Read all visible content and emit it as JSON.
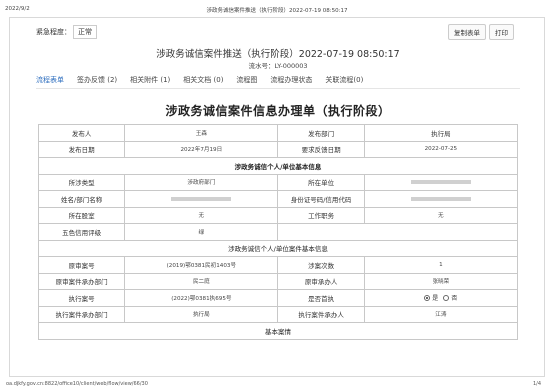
{
  "print_header": {
    "date": "2022/9/2",
    "title": "涉政务诚信案件推送（执行阶段）2022-07-19 08:50:17"
  },
  "urgency": {
    "label": "紧急程度：",
    "value": "正常"
  },
  "toolbar": {
    "copy_label": "复制表单",
    "print_label": "打印"
  },
  "case": {
    "title": "涉政务诚信案件推送（执行阶段）2022-07-19 08:50:17",
    "flow_no": "流水号：LY-000003"
  },
  "tabs": [
    {
      "label": "流程表单",
      "active": true
    },
    {
      "label": "签办反馈 (2)"
    },
    {
      "label": "相关附件 (1)"
    },
    {
      "label": "相关文档 (0)"
    },
    {
      "label": "流程图"
    },
    {
      "label": "流程办理状态"
    },
    {
      "label": "关联流程(0)"
    }
  ],
  "form": {
    "title": "涉政务诚信案件信息办理单（执行阶段）",
    "row1": {
      "l1": "发布人",
      "v1": "王森",
      "l2": "发布部门",
      "v2": "执行局"
    },
    "row2": {
      "l1": "发布日期",
      "v1": "2022年7月19日",
      "l2": "要求反馈日期",
      "v2": "2022-07-25"
    },
    "section1": "涉政务诚信个人/单位基本信息",
    "row3": {
      "l1": "所涉类型",
      "v1": "涉政府部门",
      "l2": "所在单位",
      "v2": ""
    },
    "row4": {
      "l1": "姓名/部门名称",
      "v1": "",
      "l2": "身份证号码/信用代码",
      "v2": ""
    },
    "row5": {
      "l1": "所在股室",
      "v1": "无",
      "l2": "工作职务",
      "v2": "无"
    },
    "row6": {
      "l1": "五色信用评级",
      "v1": "绿"
    },
    "section2": "涉政务诚信个人/单位案件基本信息",
    "row7": {
      "l1": "原审案号",
      "v1": "(2019)鄂0381民初1403号",
      "l2": "涉案次数",
      "v2": "1"
    },
    "row8": {
      "l1": "原审案件承办部门",
      "v1": "民二庭",
      "l2": "原审承办人",
      "v2": "张晓荣"
    },
    "row9": {
      "l1": "执行案号",
      "v1": "(2022)鄂0381执695号",
      "l2": "是否首执",
      "yes": "是",
      "no": "否"
    },
    "row10": {
      "l1": "执行案件承办部门",
      "v1": "执行局",
      "l2": "执行案件承办人",
      "v2": "江涛"
    },
    "section3": "基本案情"
  },
  "footer": {
    "url": "oa.djkfy.gov.cn:8822/office10/client/web/flow/view/66/30",
    "page": "1/4"
  }
}
